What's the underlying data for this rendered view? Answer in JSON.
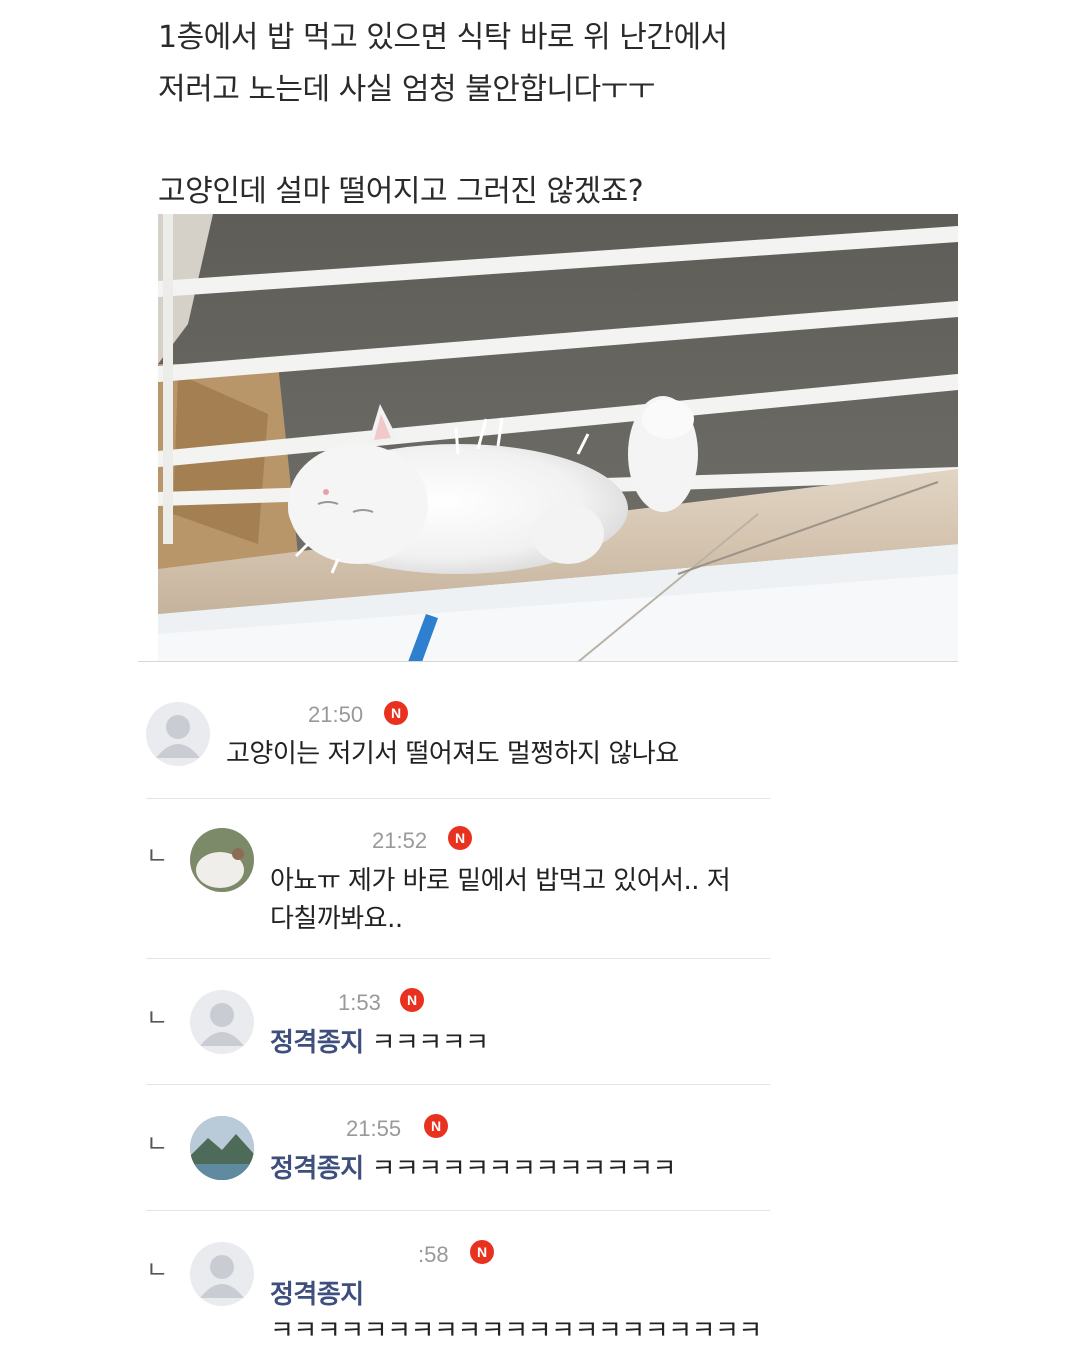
{
  "post": {
    "lines": [
      "1층에서 밥 먹고 있으면 식탁 바로 위 난간에서",
      "저러고 노는데 사실 엄청 불안합니다ㅜㅜ",
      "고양인데 설마 떨어지고 그러진 않겠죠?"
    ]
  },
  "comments": [
    {
      "time": "21:50",
      "badge": "N",
      "text": "고양이는 저기서 떨어져도 멀쩡하지 않나요"
    },
    {
      "reply_mark": "ㄴ",
      "time": "21:52",
      "badge": "N",
      "text_line1": "아뇨ㅠ 제가 바로 밑에서 밥먹고 있어서.. 저",
      "text_line2": "다칠까봐요.."
    },
    {
      "reply_mark": "ㄴ",
      "time": "1:53",
      "badge": "N",
      "mention": "정격종지",
      "text": "ㅋㅋㅋㅋㅋ"
    },
    {
      "reply_mark": "ㄴ",
      "time": "21:55",
      "badge": "N",
      "mention": "정격종지",
      "text": "ㅋㅋㅋㅋㅋㅋㅋㅋㅋㅋㅋㅋㅋ"
    },
    {
      "reply_mark": "ㄴ",
      "time": ":58",
      "badge": "N",
      "mention": "정격종지",
      "text": "ㅋㅋㅋㅋㅋㅋㅋㅋㅋㅋㅋㅋㅋㅋㅋㅋㅋㅋㅋㅋㅋ"
    }
  ],
  "icons": {
    "default_avatar": "person-silhouette-icon",
    "new_badge": "new-badge-icon"
  },
  "colors": {
    "badge": "#e8311e",
    "mention": "#3e4f7e",
    "time": "#999999"
  }
}
